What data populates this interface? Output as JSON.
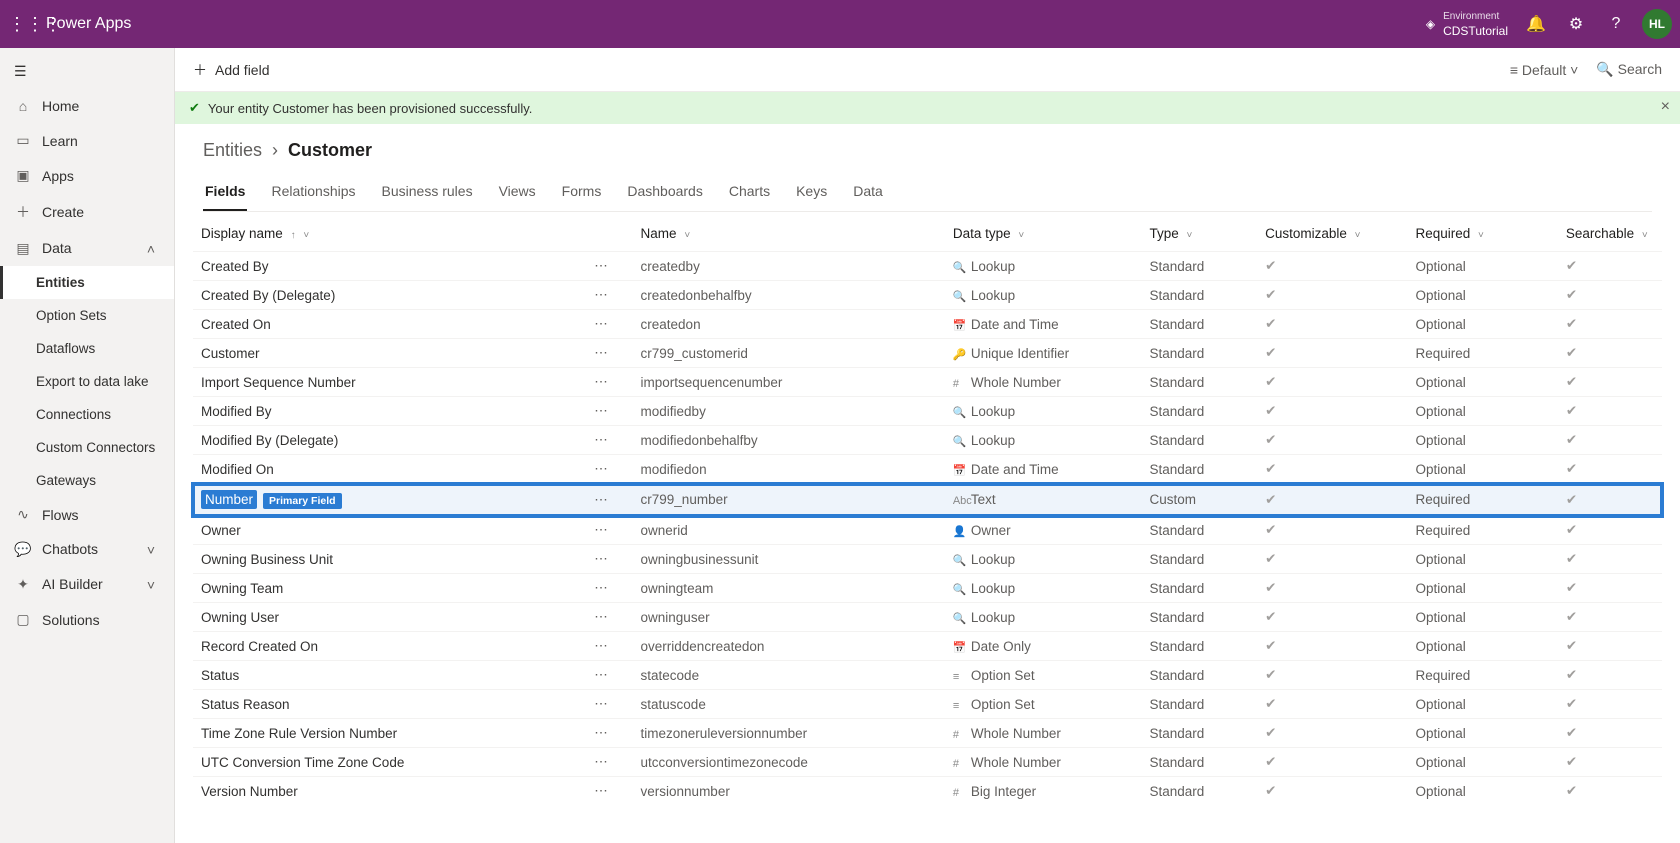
{
  "topbar": {
    "brand": "Power Apps",
    "env_label": "Environment",
    "env_value": "CDSTutorial",
    "avatar": "HL"
  },
  "sidebar": {
    "home": "Home",
    "learn": "Learn",
    "apps": "Apps",
    "create": "Create",
    "data": "Data",
    "entities": "Entities",
    "option_sets": "Option Sets",
    "dataflows": "Dataflows",
    "export": "Export to data lake",
    "connections": "Connections",
    "custom_connectors": "Custom Connectors",
    "gateways": "Gateways",
    "flows": "Flows",
    "chatbots": "Chatbots",
    "ai_builder": "AI Builder",
    "solutions": "Solutions"
  },
  "cmdbar": {
    "add_field": "Add field",
    "view": "Default",
    "search": "Search"
  },
  "banner": {
    "text": "Your entity Customer has been provisioned successfully."
  },
  "breadcrumb": {
    "root": "Entities",
    "current": "Customer"
  },
  "tabs": [
    "Fields",
    "Relationships",
    "Business rules",
    "Views",
    "Forms",
    "Dashboards",
    "Charts",
    "Keys",
    "Data"
  ],
  "columns": {
    "display": "Display name",
    "name": "Name",
    "datatype": "Data type",
    "type": "Type",
    "customizable": "Customizable",
    "required": "Required",
    "searchable": "Searchable"
  },
  "rows": [
    {
      "display": "Created By",
      "name": "createdby",
      "datatype": "Lookup",
      "type": "Standard",
      "customizable": true,
      "required": "Optional",
      "searchable": true
    },
    {
      "display": "Created By (Delegate)",
      "name": "createdonbehalfby",
      "datatype": "Lookup",
      "type": "Standard",
      "customizable": true,
      "required": "Optional",
      "searchable": true
    },
    {
      "display": "Created On",
      "name": "createdon",
      "datatype": "Date and Time",
      "type": "Standard",
      "customizable": true,
      "required": "Optional",
      "searchable": true
    },
    {
      "display": "Customer",
      "name": "cr799_customerid",
      "datatype": "Unique Identifier",
      "type": "Standard",
      "customizable": true,
      "required": "Required",
      "searchable": true
    },
    {
      "display": "Import Sequence Number",
      "name": "importsequencenumber",
      "datatype": "Whole Number",
      "type": "Standard",
      "customizable": true,
      "required": "Optional",
      "searchable": true
    },
    {
      "display": "Modified By",
      "name": "modifiedby",
      "datatype": "Lookup",
      "type": "Standard",
      "customizable": true,
      "required": "Optional",
      "searchable": true
    },
    {
      "display": "Modified By (Delegate)",
      "name": "modifiedonbehalfby",
      "datatype": "Lookup",
      "type": "Standard",
      "customizable": true,
      "required": "Optional",
      "searchable": true
    },
    {
      "display": "Modified On",
      "name": "modifiedon",
      "datatype": "Date and Time",
      "type": "Standard",
      "customizable": true,
      "required": "Optional",
      "searchable": true
    },
    {
      "display": "Number",
      "badge": "Primary Field",
      "name": "cr799_number",
      "datatype": "Text",
      "type": "Custom",
      "customizable": true,
      "required": "Required",
      "searchable": true,
      "highlight": true
    },
    {
      "display": "Owner",
      "name": "ownerid",
      "datatype": "Owner",
      "type": "Standard",
      "customizable": true,
      "required": "Required",
      "searchable": true
    },
    {
      "display": "Owning Business Unit",
      "name": "owningbusinessunit",
      "datatype": "Lookup",
      "type": "Standard",
      "customizable": true,
      "required": "Optional",
      "searchable": true
    },
    {
      "display": "Owning Team",
      "name": "owningteam",
      "datatype": "Lookup",
      "type": "Standard",
      "customizable": true,
      "required": "Optional",
      "searchable": true
    },
    {
      "display": "Owning User",
      "name": "owninguser",
      "datatype": "Lookup",
      "type": "Standard",
      "customizable": true,
      "required": "Optional",
      "searchable": true
    },
    {
      "display": "Record Created On",
      "name": "overriddencreatedon",
      "datatype": "Date Only",
      "type": "Standard",
      "customizable": true,
      "required": "Optional",
      "searchable": true
    },
    {
      "display": "Status",
      "name": "statecode",
      "datatype": "Option Set",
      "type": "Standard",
      "customizable": true,
      "required": "Required",
      "searchable": true
    },
    {
      "display": "Status Reason",
      "name": "statuscode",
      "datatype": "Option Set",
      "type": "Standard",
      "customizable": true,
      "required": "Optional",
      "searchable": true
    },
    {
      "display": "Time Zone Rule Version Number",
      "name": "timezoneruleversionnumber",
      "datatype": "Whole Number",
      "type": "Standard",
      "customizable": true,
      "required": "Optional",
      "searchable": true
    },
    {
      "display": "UTC Conversion Time Zone Code",
      "name": "utcconversiontimezonecode",
      "datatype": "Whole Number",
      "type": "Standard",
      "customizable": true,
      "required": "Optional",
      "searchable": true
    },
    {
      "display": "Version Number",
      "name": "versionnumber",
      "datatype": "Big Integer",
      "type": "Standard",
      "customizable": true,
      "required": "Optional",
      "searchable": true
    }
  ]
}
